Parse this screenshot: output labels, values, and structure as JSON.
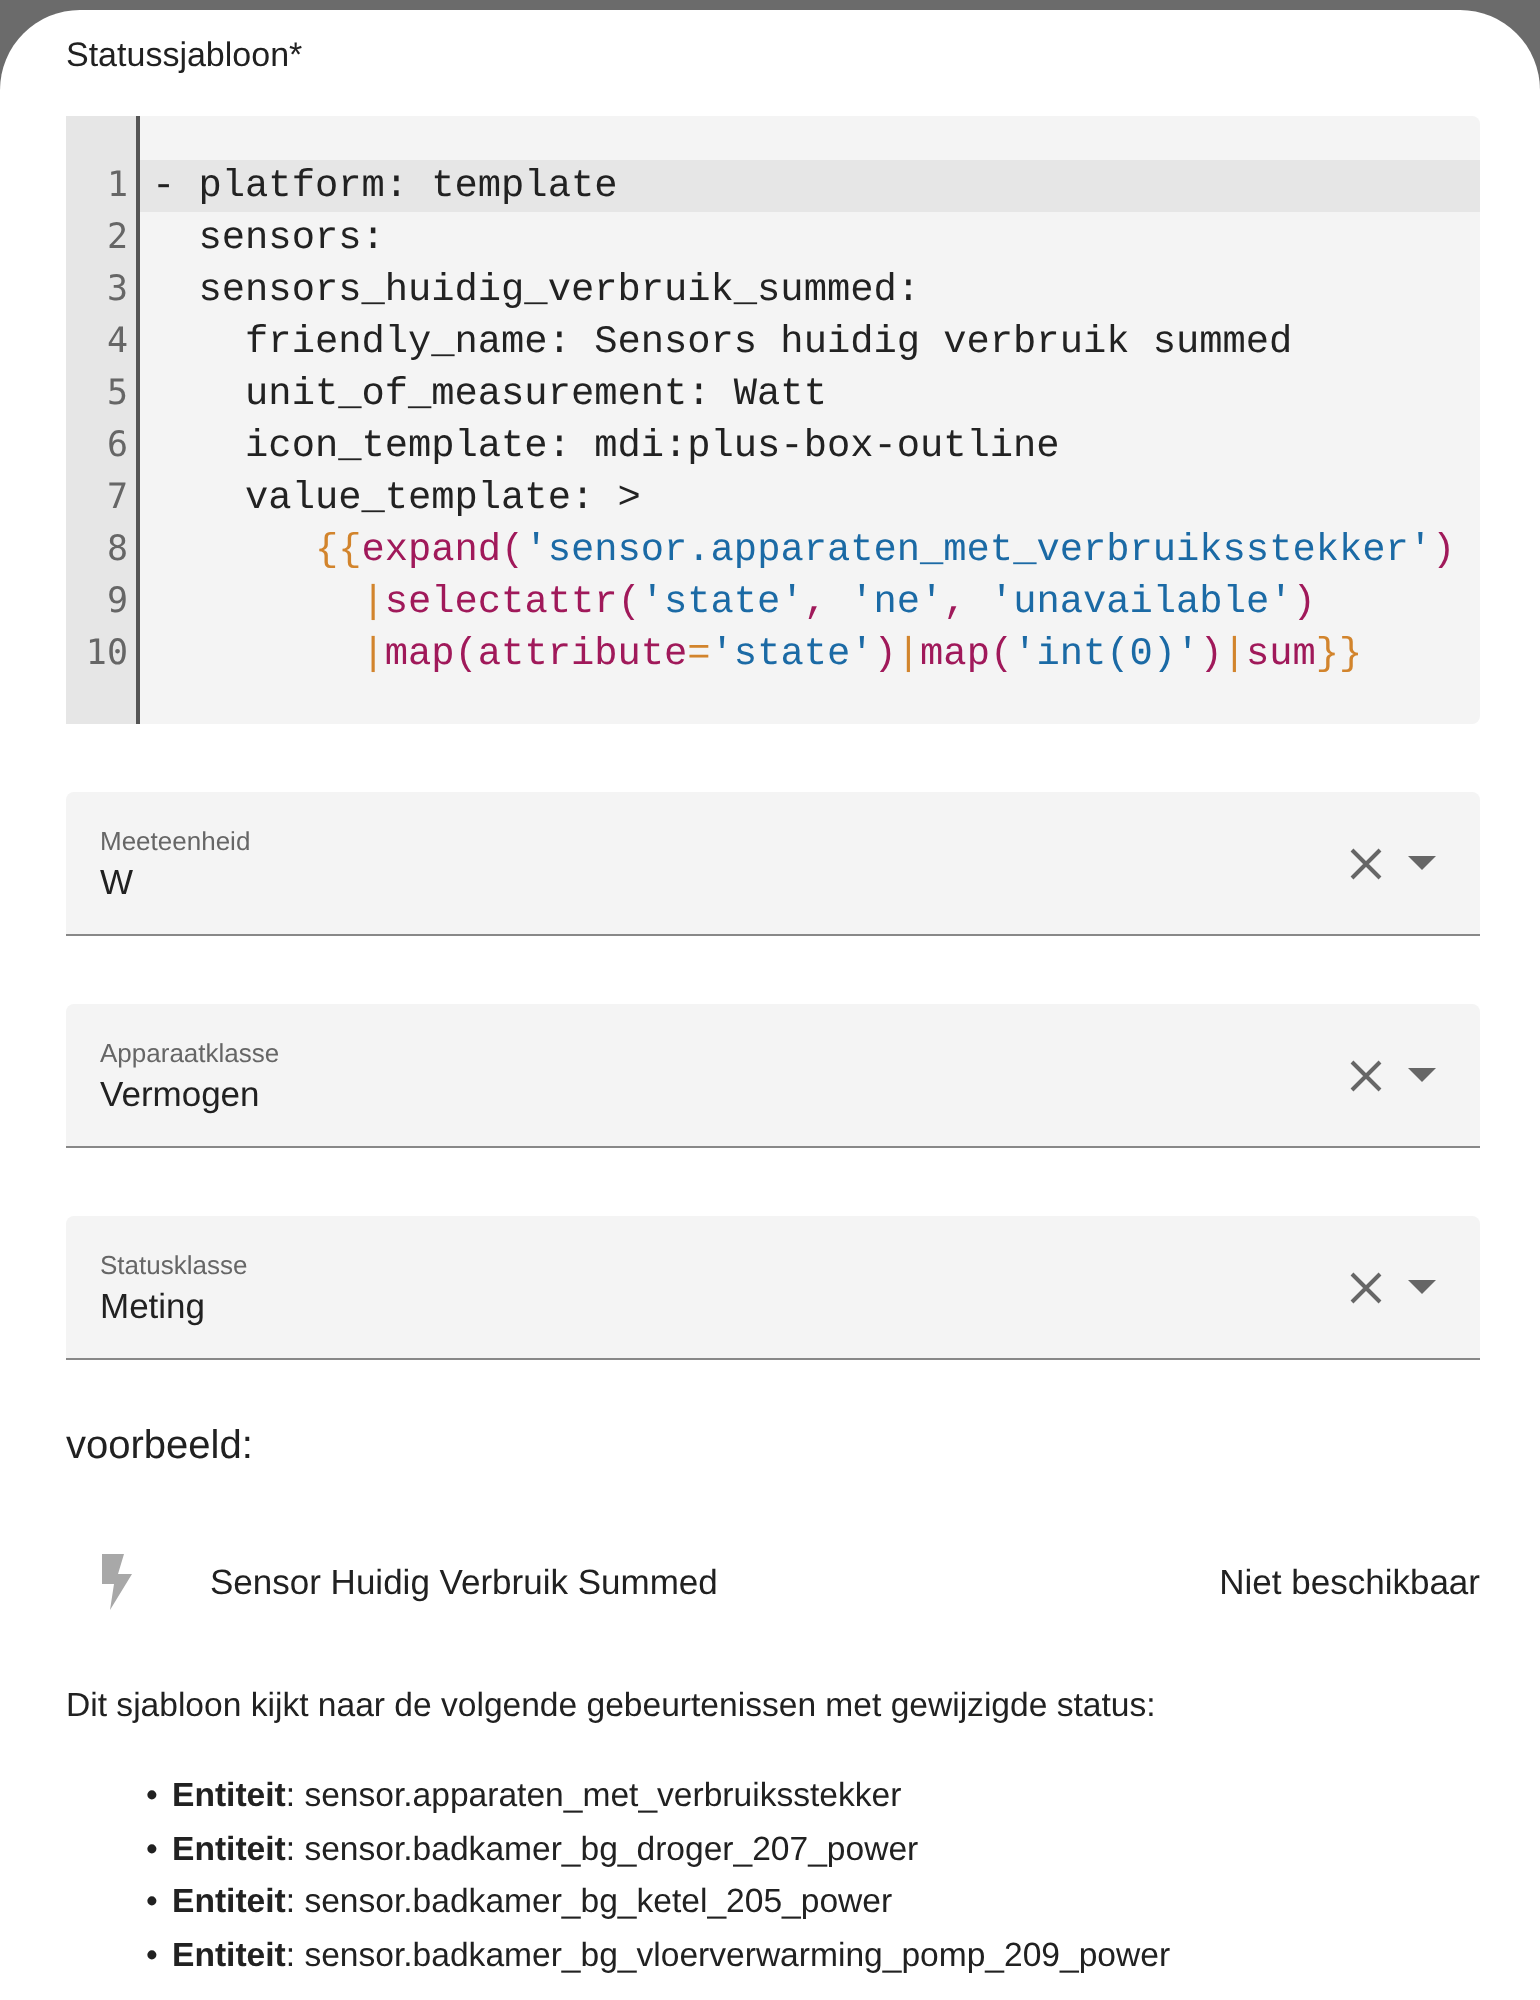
{
  "title": "Statussjabloon*",
  "code": [
    {
      "number": "1",
      "active": true,
      "tokens": [
        {
          "kind": "plain",
          "text": "- platform: template"
        }
      ]
    },
    {
      "number": "2",
      "active": false,
      "tokens": [
        {
          "kind": "plain",
          "text": "  sensors:"
        }
      ]
    },
    {
      "number": "3",
      "active": false,
      "tokens": [
        {
          "kind": "plain",
          "text": "  sensors_huidig_verbruik_summed:"
        }
      ]
    },
    {
      "number": "4",
      "active": false,
      "tokens": [
        {
          "kind": "plain",
          "text": "    friendly_name: Sensors huidig verbruik summed"
        }
      ]
    },
    {
      "number": "5",
      "active": false,
      "tokens": [
        {
          "kind": "plain",
          "text": "    unit_of_measurement: Watt"
        }
      ]
    },
    {
      "number": "6",
      "active": false,
      "tokens": [
        {
          "kind": "plain",
          "text": "    icon_template: mdi:plus-box-outline"
        }
      ]
    },
    {
      "number": "7",
      "active": false,
      "tokens": [
        {
          "kind": "plain",
          "text": "    value_template: >"
        }
      ]
    },
    {
      "number": "8",
      "active": false,
      "tokens": [
        {
          "kind": "delimiter",
          "text": "       {{"
        },
        {
          "kind": "function",
          "text": "expand("
        },
        {
          "kind": "string",
          "text": "'sensor.apparaten_met_verbruiksstekker'"
        },
        {
          "kind": "function",
          "text": ")"
        }
      ]
    },
    {
      "number": "9",
      "active": false,
      "tokens": [
        {
          "kind": "delimiter",
          "text": "         |"
        },
        {
          "kind": "function",
          "text": "selectattr("
        },
        {
          "kind": "string",
          "text": "'state'"
        },
        {
          "kind": "function",
          "text": ", "
        },
        {
          "kind": "string",
          "text": "'ne'"
        },
        {
          "kind": "function",
          "text": ", "
        },
        {
          "kind": "string",
          "text": "'unavailable'"
        },
        {
          "kind": "function",
          "text": ")"
        }
      ]
    },
    {
      "number": "10",
      "active": false,
      "tokens": [
        {
          "kind": "delimiter",
          "text": "         |"
        },
        {
          "kind": "function",
          "text": "map(attribute"
        },
        {
          "kind": "delimiter",
          "text": "="
        },
        {
          "kind": "string",
          "text": "'state'"
        },
        {
          "kind": "function",
          "text": ")"
        },
        {
          "kind": "delimiter",
          "text": "|"
        },
        {
          "kind": "function",
          "text": "map("
        },
        {
          "kind": "string",
          "text": "'int(0)'"
        },
        {
          "kind": "function",
          "text": ")"
        },
        {
          "kind": "delimiter",
          "text": "|"
        },
        {
          "kind": "function",
          "text": "sum"
        },
        {
          "kind": "delimiter",
          "text": "}}"
        }
      ]
    }
  ],
  "fields": [
    {
      "label": "Meeteenheid",
      "value": "W"
    },
    {
      "label": "Apparaatklasse",
      "value": "Vermogen"
    },
    {
      "label": "Statusklasse",
      "value": "Meting"
    }
  ],
  "preview": {
    "heading": "voorbeeld:",
    "name": "Sensor Huidig Verbruik Summed",
    "state": "Niet beschikbaar"
  },
  "listeners": {
    "intro": "Dit sjabloon kijkt naar de volgende gebeurtenissen met gewijzigde status:",
    "items": [
      {
        "bullet": "•",
        "text": "**Entiteit**: sensor.apparaten_met_verbruiksstekker"
      },
      {
        "bullet": "•",
        "text": "**Entiteit**: sensor.badkamer_bg_droger_207_power"
      },
      {
        "bullet": "•",
        "text": "**Entiteit**: sensor.badkamer_bg_ketel_205_power"
      },
      {
        "bullet": "•",
        "text": "**Entiteit**: sensor.badkamer_bg_vloerverwarming_pomp_209_power"
      }
    ]
  }
}
